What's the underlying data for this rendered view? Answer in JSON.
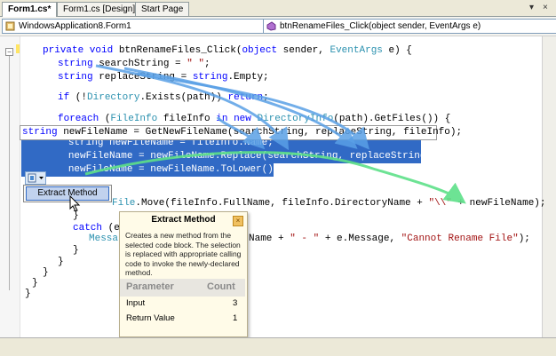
{
  "tabs": [
    {
      "label": "Form1.cs*",
      "active": true
    },
    {
      "label": "Form1.cs [Design]*",
      "active": false
    },
    {
      "label": "Start Page",
      "active": false
    }
  ],
  "window_controls": {
    "dropdown": "▾",
    "close": "×"
  },
  "nav": {
    "class_combo": "WindowsApplication8.Form1",
    "member_combo": "btnRenameFiles_Click(object sender, EventArgs e)"
  },
  "code": {
    "l1_kw": "private void",
    "l1_name": " btnRenameFiles_Click(",
    "l1_obj": "object",
    "l1_mid": " sender, ",
    "l1_type": "EventArgs",
    "l1_end": " e) {",
    "l2_kw": "string",
    "l2_rest": " searchString = ",
    "l2_str": "\" \"",
    "l2_end": ";",
    "l3_kw": "string",
    "l3_rest": " replaceString = ",
    "l3_str_kw": "string",
    "l3_end": ".Empty;",
    "l4_kw": "if",
    "l4_rest": " (!",
    "l4_type": "Directory",
    "l4_mid": ".Exists(path)) ",
    "l4_kw2": "return",
    "l4_end": ";",
    "l5_kw": "foreach",
    "l5_a": " (",
    "l5_type": "FileInfo",
    "l5_b": " fileInfo ",
    "l5_in": "in",
    "l5_c": " ",
    "l5_new": "new",
    "l5_d": " ",
    "l5_type2": "DirectoryInfo",
    "l5_end": "(path).GetFiles()) {",
    "l6_open": "{",
    "sel1_kw": "string",
    "sel1_rest": " newFileName = fileInfo.Name;",
    "sel2": "newFileName = newFileName.Replace(searchString, replaceString);",
    "sel3": "newFileName = newFileName.ToLower();",
    "l9_kw": "try",
    "l10_type": "File",
    "l10_rest": ".Move(fileInfo.FullName, fileInfo.DirectoryName + ",
    "l10_str": "\"\\\\\"",
    "l10_end": " + newFileName);",
    "l11_close": "}",
    "l12_kw": "catch",
    "l12_rest": " (e",
    "l13_a": "Messa",
    "l13_b": "Name + ",
    "l13_str1": "\" - \"",
    "l13_c": " + e.Message, ",
    "l13_str2": "\"Cannot Rename File\"",
    "l13_end": ");",
    "l14_close": "}",
    "l15_close": "}",
    "l16_close": "}",
    "l17_close": "}",
    "l18_close": "}"
  },
  "preview_line": {
    "kw": "string",
    "rest": " newFileName = GetNewFileName(searchString, replaceString, fileInfo);"
  },
  "smart_tag_menu": {
    "item": "Extract Method"
  },
  "tooltip": {
    "title": "Extract Method",
    "close": "×",
    "body": "Creates a new method from the selected code block. The selection is replaced with appropriate calling code to invoke the newly-declared method.",
    "col_param": "Parameter",
    "col_count": "Count",
    "rows": [
      {
        "label": "Input",
        "count": "3"
      },
      {
        "label": "Return Value",
        "count": "1"
      }
    ]
  },
  "colors": {
    "input_arrow": "#5aa0e6",
    "return_arrow": "#5ee089",
    "selection": "#316ac5",
    "keyword": "#0000ff",
    "type": "#2b91af",
    "string": "#a31515"
  }
}
